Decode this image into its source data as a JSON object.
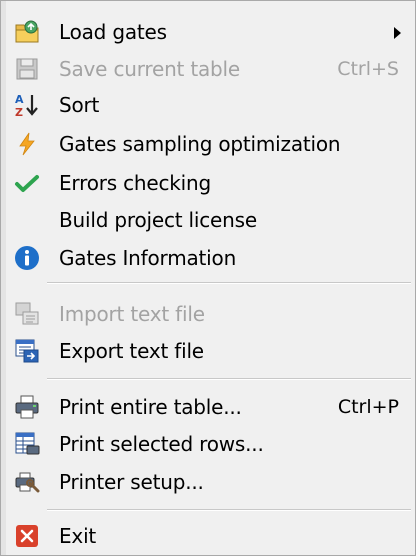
{
  "menu": {
    "items": [
      {
        "label": "Load gates",
        "icon": "folder-icon",
        "submenu": true
      },
      {
        "label": "Save current table",
        "shortcut": "Ctrl+S",
        "icon": "save-icon",
        "disabled": true
      },
      {
        "label": "Sort",
        "icon": "sort-az-icon"
      },
      {
        "label": "Gates sampling optimization",
        "icon": "lightning-icon"
      },
      {
        "label": "Errors checking",
        "icon": "checkmark-icon"
      },
      {
        "label": "Build project license",
        "icon": ""
      },
      {
        "label": "Gates Information",
        "icon": "info-icon"
      },
      {
        "label": "Import text file",
        "icon": "import-icon",
        "disabled": true
      },
      {
        "label": "Export text file",
        "icon": "export-icon"
      },
      {
        "label": "Print entire table...",
        "shortcut": "Ctrl+P",
        "icon": "printer-icon"
      },
      {
        "label": "Print selected rows...",
        "icon": "print-rows-icon"
      },
      {
        "label": "Printer setup...",
        "icon": "printer-setup-icon"
      },
      {
        "label": "Exit",
        "icon": "exit-icon"
      }
    ]
  },
  "colors": {
    "menu_bg": "#f0f0f0",
    "disabled_text": "#a3a3a3",
    "info_blue": "#1e6fc9",
    "check_green": "#2ea44f",
    "exit_red": "#d9412b",
    "lightning_orange": "#f5a623"
  }
}
